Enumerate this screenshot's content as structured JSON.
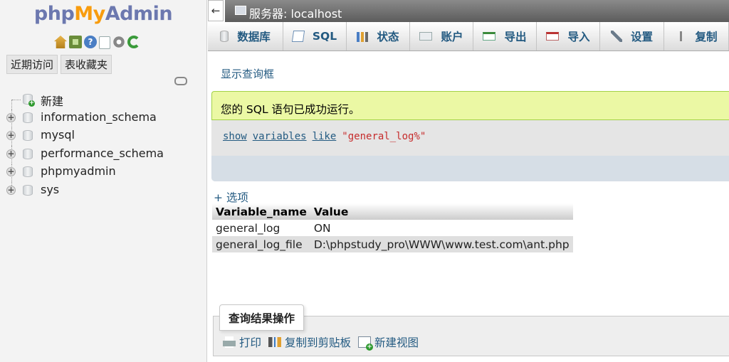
{
  "logo": {
    "php": "php",
    "my": "My",
    "admin": "Admin"
  },
  "nav_tabs": {
    "recent": "近期访问",
    "favorites": "表收藏夹"
  },
  "tree": {
    "new_label": "新建",
    "databases": [
      "information_schema",
      "mysql",
      "performance_schema",
      "phpmyadmin",
      "sys"
    ]
  },
  "header": {
    "collapse": "←",
    "server_label": "服务器: localhost"
  },
  "menu": [
    {
      "label": "数据库",
      "icon": "database-icon"
    },
    {
      "label": "SQL",
      "icon": "sql-icon"
    },
    {
      "label": "状态",
      "icon": "status-icon"
    },
    {
      "label": "账户",
      "icon": "users-icon"
    },
    {
      "label": "导出",
      "icon": "export-icon"
    },
    {
      "label": "导入",
      "icon": "import-icon"
    },
    {
      "label": "设置",
      "icon": "settings-icon"
    },
    {
      "label": "复制",
      "icon": "replication-icon"
    }
  ],
  "main": {
    "show_query": "显示查询框",
    "success_message": "您的 SQL 语句已成功运行。",
    "sql": {
      "kw1": "show",
      "kw2": "variables",
      "kw3": "like",
      "string": "\"general_log%\""
    },
    "options": "+ 选项"
  },
  "results": {
    "columns": [
      "Variable_name",
      "Value"
    ],
    "rows": [
      [
        "general_log",
        "ON"
      ],
      [
        "general_log_file",
        "D:\\phpstudy_pro\\WWW\\www.test.com\\ant.php"
      ]
    ]
  },
  "operations": {
    "legend": "查询结果操作",
    "print": "打印",
    "copy_clipboard": "复制到剪贴板",
    "create_view": "新建视图"
  }
}
